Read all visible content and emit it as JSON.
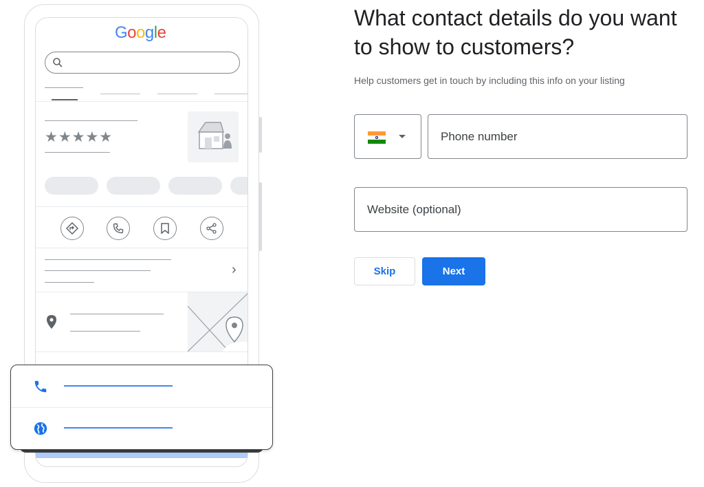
{
  "illustration": {
    "logo_text": "Google",
    "rating_stars": "★★★★★",
    "chevron": "›"
  },
  "form": {
    "title": "What contact details do you want to show to customers?",
    "subtitle": "Help customers get in touch by including this info on your listing",
    "country_code": "IN",
    "phone_placeholder": "Phone number",
    "website_placeholder": "Website (optional)",
    "skip_label": "Skip",
    "next_label": "Next"
  },
  "colors": {
    "accent": "#1a73e8",
    "border": "#80868b"
  }
}
